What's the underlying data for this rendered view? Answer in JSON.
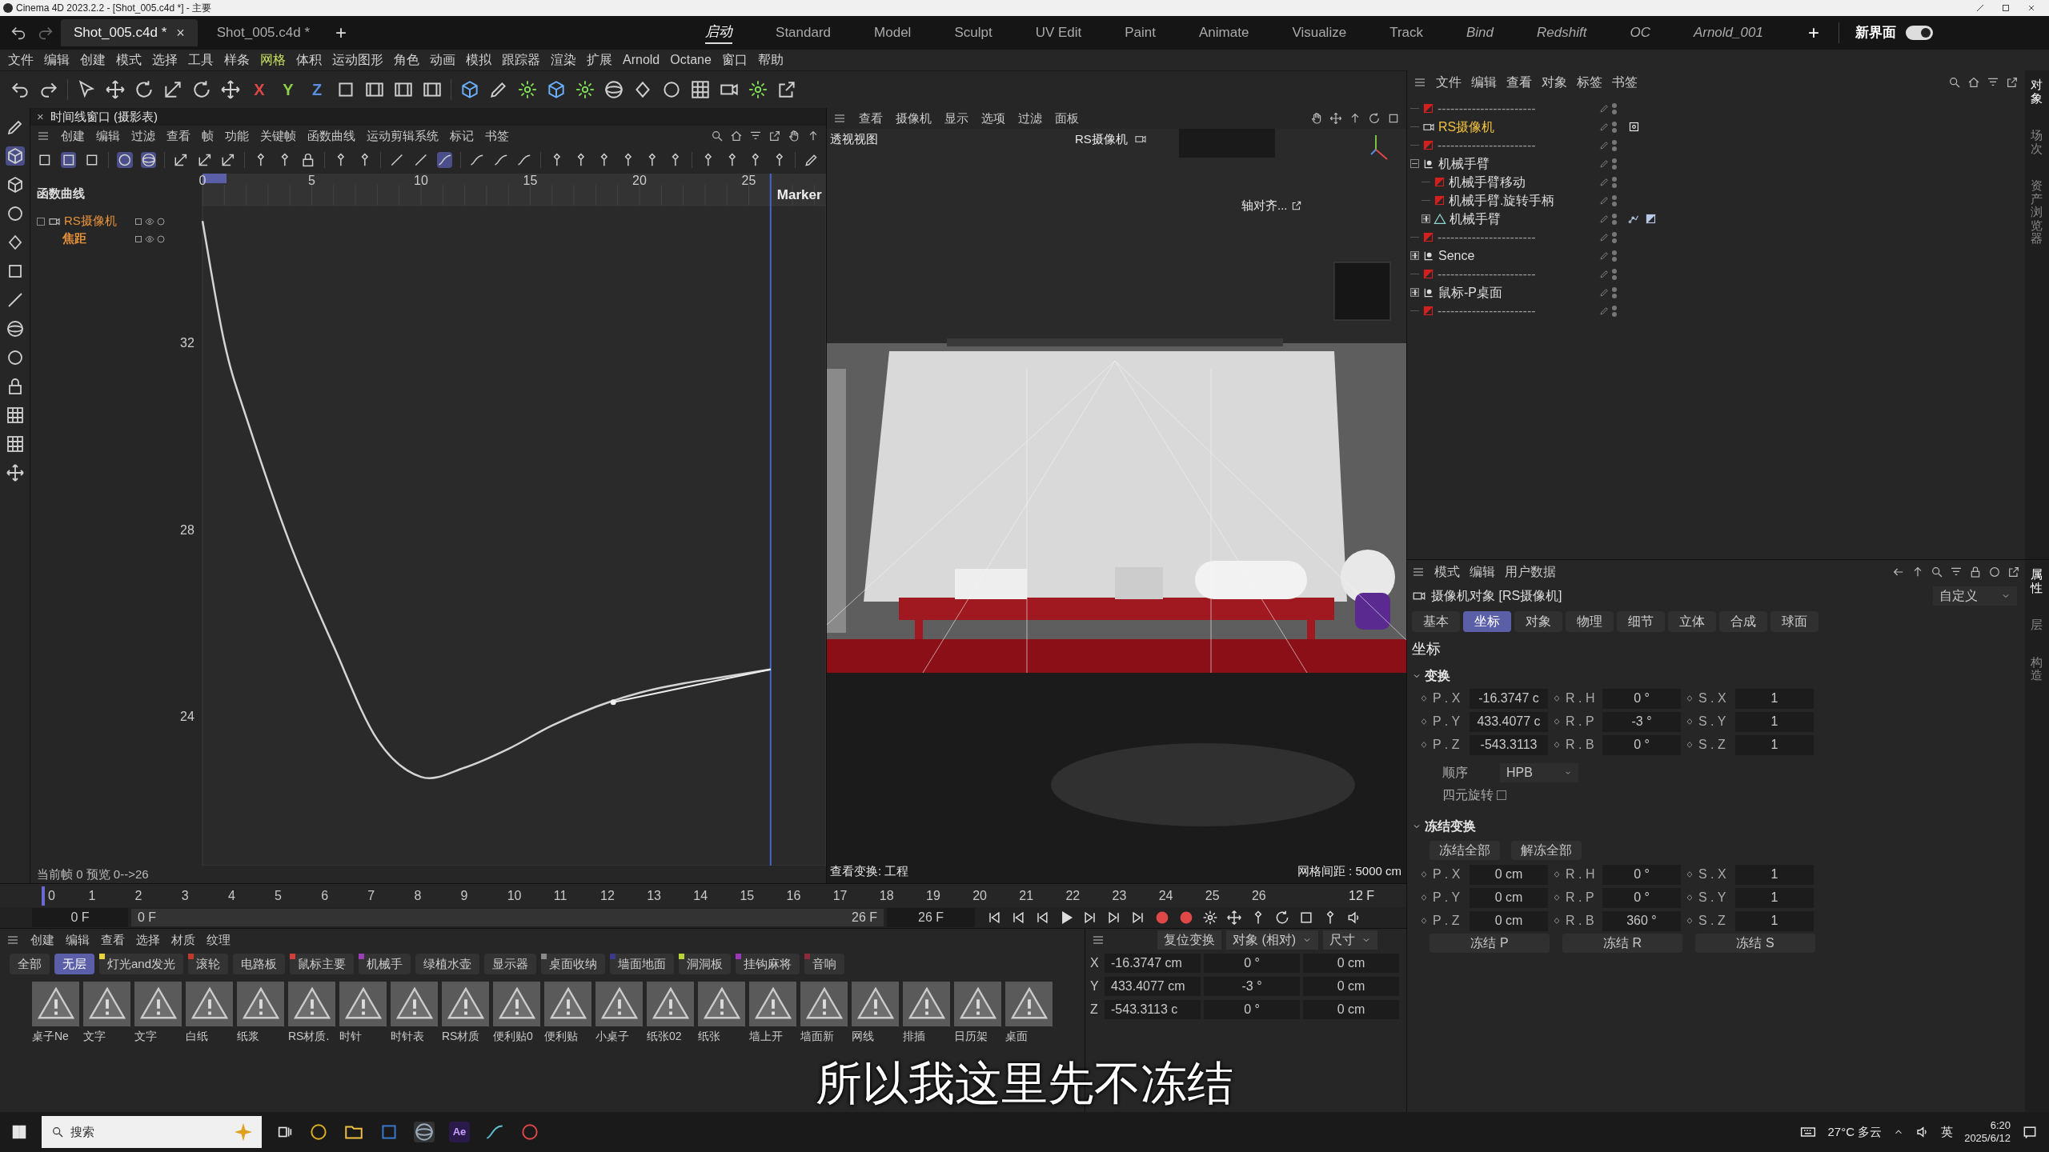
{
  "title_bar": {
    "title": "Cinema 4D 2023.2.2 - [Shot_005.c4d *] - 主要"
  },
  "doc_tabs": [
    {
      "label": "Shot_005.c4d *",
      "selected": true,
      "close": "×"
    },
    {
      "label": "Shot_005.c4d *",
      "selected": false
    }
  ],
  "new_tab": "+",
  "layouts": [
    {
      "label": "启动",
      "selected": true,
      "custom": true
    },
    {
      "label": "Standard",
      "selected": false,
      "custom": false
    },
    {
      "label": "Model",
      "selected": false,
      "custom": false
    },
    {
      "label": "Sculpt",
      "selected": false,
      "custom": false
    },
    {
      "label": "UV Edit",
      "selected": false,
      "custom": false
    },
    {
      "label": "Paint",
      "selected": false,
      "custom": false
    },
    {
      "label": "Animate",
      "selected": false,
      "custom": false
    },
    {
      "label": "Visualize",
      "selected": false,
      "custom": false
    },
    {
      "label": "Track",
      "selected": false,
      "custom": false
    },
    {
      "label": "Bind",
      "selected": false,
      "custom": true
    },
    {
      "label": "Redshift",
      "selected": false,
      "custom": true
    },
    {
      "label": "OC",
      "selected": false,
      "custom": true
    },
    {
      "label": "Arnold_001",
      "selected": false,
      "custom": true
    }
  ],
  "layout_add": "+",
  "layout_name": "新界面",
  "layout_toggle_on": true,
  "menu": [
    {
      "label": "文件",
      "highlighted": false
    },
    {
      "label": "编辑",
      "highlighted": false
    },
    {
      "label": "创建",
      "highlighted": false
    },
    {
      "label": "模式",
      "highlighted": false
    },
    {
      "label": "选择",
      "highlighted": false
    },
    {
      "label": "工具",
      "highlighted": false
    },
    {
      "label": "样条",
      "highlighted": false
    },
    {
      "label": "网格",
      "highlighted": true
    },
    {
      "label": "体积",
      "highlighted": false
    },
    {
      "label": "运动图形",
      "highlighted": false
    },
    {
      "label": "角色",
      "highlighted": false
    },
    {
      "label": "动画",
      "highlighted": false
    },
    {
      "label": "模拟",
      "highlighted": false
    },
    {
      "label": "跟踪器",
      "highlighted": false
    },
    {
      "label": "渲染",
      "highlighted": false
    },
    {
      "label": "扩展",
      "highlighted": false
    },
    {
      "label": "Arnold",
      "highlighted": false
    },
    {
      "label": "Octane",
      "highlighted": false
    },
    {
      "label": "窗口",
      "highlighted": false
    },
    {
      "label": "帮助",
      "highlighted": false
    }
  ],
  "toolbar": {
    "axes": [
      {
        "label": "X",
        "color": "#e04848"
      },
      {
        "label": "Y",
        "color": "#8ccf4a"
      },
      {
        "label": "Z",
        "color": "#5a8ee0"
      }
    ]
  },
  "timeline": {
    "title": "时间线窗口 (摄影表)",
    "close": "×",
    "menu": [
      "创建",
      "编辑",
      "过滤",
      "查看",
      "帧",
      "功能",
      "关键帧",
      "函数曲线",
      "运动剪辑系统",
      "标记",
      "书签"
    ],
    "tree_header": "函数曲线",
    "tracks": [
      {
        "label": "RS摄像机",
        "kind": "object"
      }
    ],
    "chart_data": {
      "type": "line",
      "x": [
        0,
        1,
        2,
        4,
        6,
        8,
        10,
        12,
        14,
        16,
        18,
        20,
        22,
        24,
        26
      ],
      "series": [
        {
          "name": "焦距",
          "color": "#d4d4d4",
          "values": [
            34.6,
            32.0,
            30.4,
            27.7,
            25.5,
            23.5,
            22.7,
            22.9,
            23.3,
            23.8,
            24.2,
            24.5,
            24.7,
            24.85,
            25.0
          ]
        }
      ],
      "ref_lines": [
        {
          "axis": "x",
          "value": 26,
          "label": "Marker"
        }
      ],
      "xlim": [
        0,
        28.53
      ],
      "ylim": [
        20.8,
        34.93
      ],
      "xticks": [
        0,
        5,
        10,
        15,
        20,
        25
      ],
      "yticks": [
        24,
        28,
        32
      ]
    },
    "status": "当前帧  0  预览  0-->26"
  },
  "viewport": {
    "menu": [
      "查看",
      "摄像机",
      "显示",
      "选项",
      "过滤",
      "面板"
    ],
    "view_name": "透视视图",
    "camera": "RS摄像机",
    "align_label": "轴对齐...",
    "view_transform": "查看变换: 工程",
    "grid_spacing": "网格间距 : 5000 cm"
  },
  "frame_ruler": {
    "ticks": [
      "0",
      "1",
      "2",
      "3",
      "4",
      "5",
      "6",
      "7",
      "8",
      "9",
      "10",
      "11",
      "12",
      "13",
      "14",
      "15",
      "16",
      "17",
      "18",
      "19",
      "20",
      "21",
      "22",
      "23",
      "24",
      "25",
      "26"
    ],
    "end_label": "12 F"
  },
  "time_controls": {
    "level": 1,
    "start": "0 F",
    "range_start": "0 F",
    "range_end": "26 F",
    "end": "26 F"
  },
  "material_manager": {
    "menu": [
      "创建",
      "编辑",
      "查看",
      "选择",
      "材质",
      "纹理"
    ],
    "layers": [
      {
        "label": "全部",
        "selected": false
      },
      {
        "label": "无层",
        "selected": true
      },
      {
        "label": "灯光and发光",
        "selected": false,
        "color": "#e8d440"
      },
      {
        "label": "滚轮",
        "selected": false,
        "color": "#c0392b"
      },
      {
        "label": "电路板",
        "selected": false
      },
      {
        "label": "鼠标主要",
        "selected": false,
        "color": "#d0403a"
      },
      {
        "label": "机械手",
        "selected": false,
        "color": "#9b3fb5"
      },
      {
        "label": "绿植水壶",
        "selected": false
      },
      {
        "label": "显示器",
        "selected": false
      },
      {
        "label": "桌面收纳",
        "selected": false,
        "color": "#8a8a8a"
      },
      {
        "label": "墙面地面",
        "selected": false,
        "color": "#3a3a8a"
      },
      {
        "label": "洞洞板",
        "selected": false,
        "color": "#b8d43a"
      },
      {
        "label": "挂钩麻将",
        "selected": false,
        "color": "#9a3ab8"
      },
      {
        "label": "音响",
        "selected": false,
        "color": "#8a2a3a"
      }
    ],
    "materials": [
      "桌子Ne",
      "文字",
      "文字",
      "白纸",
      "纸浆",
      "RS材质.",
      "时针",
      "时针表",
      "RS材质",
      "便利贴0",
      "便利贴",
      "小桌子",
      "纸张02",
      "纸张",
      "墙上开",
      "墙面新",
      "网线",
      "排插",
      "日历架",
      "桌面"
    ]
  },
  "coordinates": {
    "button": "复位变换",
    "dropdowns": [
      "对象 (相对)",
      "尺寸"
    ],
    "rows": [
      {
        "axis": "X",
        "position": "-16.3747 cm",
        "rotation": "0 °",
        "size": "0 cm"
      },
      {
        "axis": "Y",
        "position": "433.4077 cm",
        "rotation": "-3 °",
        "size": "0 cm"
      },
      {
        "axis": "Z",
        "position": "-543.3113 c",
        "rotation": "0 °",
        "size": "0 cm"
      }
    ]
  },
  "subtitle": "所以我这里先不冻结",
  "object_manager": {
    "menu": [
      "文件",
      "编辑",
      "查看",
      "对象",
      "标签",
      "书签"
    ],
    "items": [
      {
        "name": "-----------------------",
        "kind": "separator",
        "has_children": false,
        "selected": false
      },
      {
        "name": "RS摄像机",
        "kind": "camera",
        "has_children": false,
        "selected": true,
        "tags": [
          {
            "kind": "target"
          }
        ]
      },
      {
        "name": "-----------------------",
        "kind": "separator",
        "has_children": false,
        "selected": false
      },
      {
        "name": "机械手臂",
        "kind": "null",
        "has_children": true,
        "expanded": true,
        "selected": false,
        "children": [
          {
            "name": "机械手臂移动",
            "kind": "marker",
            "has_children": false,
            "selected": false
          },
          {
            "name": "机械手臂.旋转手柄",
            "kind": "marker",
            "has_children": false,
            "selected": false
          },
          {
            "name": "机械手臂",
            "kind": "mesh",
            "has_children": true,
            "expanded": false,
            "selected": false,
            "tags": [
              {
                "kind": "ik"
              },
              {
                "kind": "weight"
              }
            ]
          }
        ]
      },
      {
        "name": "-----------------------",
        "kind": "separator",
        "has_children": false,
        "selected": false
      },
      {
        "name": "Sence",
        "kind": "null",
        "has_children": true,
        "expanded": false,
        "selected": false
      },
      {
        "name": "-----------------------",
        "kind": "separator",
        "has_children": false,
        "selected": false
      },
      {
        "name": "鼠标-P桌面",
        "kind": "null",
        "has_children": true,
        "expanded": false,
        "selected": false
      },
      {
        "name": "-----------------------",
        "kind": "separator",
        "has_children": false,
        "selected": false
      }
    ],
    "side_tabs": [
      {
        "label": "对象",
        "selected": true
      },
      {
        "label": "场次",
        "selected": false
      },
      {
        "label": "资产浏览器",
        "selected": false
      }
    ]
  },
  "attributes": {
    "menu": [
      "模式",
      "编辑",
      "用户数据"
    ],
    "object_title": "摄像机对象 [RS摄像机]",
    "preset": "自定义",
    "tabs": [
      {
        "label": "基本",
        "selected": false
      },
      {
        "label": "坐标",
        "selected": true
      },
      {
        "label": "对象",
        "selected": false
      },
      {
        "label": "物理",
        "selected": false
      },
      {
        "label": "细节",
        "selected": false
      },
      {
        "label": "立体",
        "selected": false
      },
      {
        "label": "合成",
        "selected": false
      },
      {
        "label": "球面",
        "selected": false
      }
    ],
    "section": "坐标",
    "transform": {
      "title": "变换",
      "expanded": true,
      "rows": [
        {
          "p_label": "P . X",
          "p": "-16.3747 c",
          "r_label": "R . H",
          "r": "0 °",
          "s_label": "S . X",
          "s": "1"
        },
        {
          "p_label": "P . Y",
          "p": "433.4077 c",
          "r_label": "R . P",
          "r": "-3 °",
          "s_label": "S . Y",
          "s": "1"
        },
        {
          "p_label": "P . Z",
          "p": "-543.3113",
          "r_label": "R . B",
          "r": "0 °",
          "s_label": "S . Z",
          "s": "1"
        }
      ],
      "order_label": "顺序",
      "order": "HPB",
      "quaternion_label": "四元旋转",
      "quaternion": false
    },
    "freeze": {
      "title": "冻结变换",
      "expanded": true,
      "buttons": [
        "冻结全部",
        "解冻全部"
      ],
      "rows": [
        {
          "p_label": "P . X",
          "p": "0 cm",
          "r_label": "R . H",
          "r": "0 °",
          "s_label": "S . X",
          "s": "1"
        },
        {
          "p_label": "P . Y",
          "p": "0 cm",
          "r_label": "R . P",
          "r": "0 °",
          "s_label": "S . Y",
          "s": "1"
        },
        {
          "p_label": "P . Z",
          "p": "0 cm",
          "r_label": "R . B",
          "r": "360 °",
          "s_label": "S . Z",
          "s": "1"
        }
      ],
      "row_buttons": [
        "冻结 P",
        "冻结 R",
        "冻结 S"
      ]
    },
    "side_tabs": [
      {
        "label": "属性",
        "selected": true
      },
      {
        "label": "层",
        "selected": false
      },
      {
        "label": "构造",
        "selected": false
      }
    ]
  },
  "taskbar": {
    "search": "搜索",
    "ae_label": "Ae",
    "weather": "27°C 多云",
    "ime": "英",
    "time": "6:20",
    "date": "2025/6/12"
  }
}
